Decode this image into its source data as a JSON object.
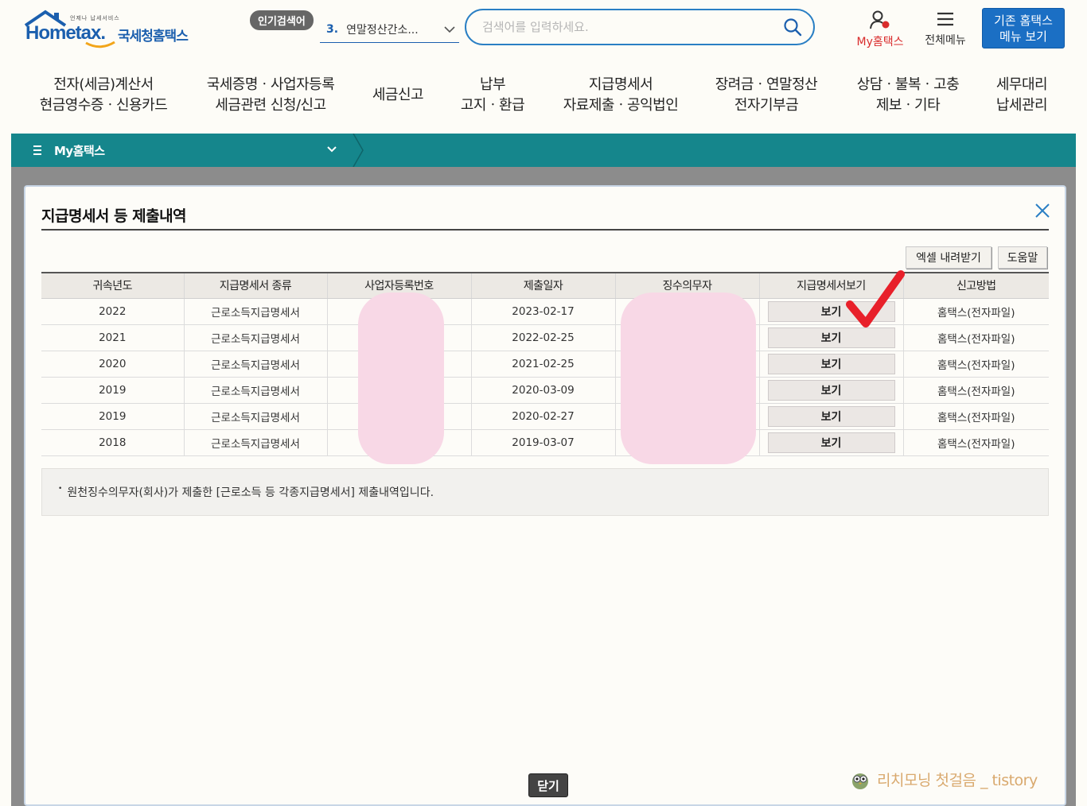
{
  "header": {
    "logo_tiny": "언제나 납세서비스",
    "logo_main": "Hometax.",
    "logo_sub": "국세청홈택스",
    "popular_badge": "인기검색어",
    "popular_num": "3.",
    "popular_text": "연말정산간소...",
    "search_placeholder": "검색어를 입력하세요.",
    "my_hometax": "My홈택스",
    "all_menu": "전체메뉴",
    "old_menu_line1": "기존 홈택스",
    "old_menu_line2": "메뉴 보기"
  },
  "gnb": [
    "전자(세금)계산서\n현금영수증ㆍ신용카드",
    "국세증명ㆍ사업자등록\n세금관련 신청/신고",
    "세금신고",
    "납부\n고지ㆍ환급",
    "지급명세서\n자료제출ㆍ공익법인",
    "장려금ㆍ연말정산\n전자기부금",
    "상담ㆍ불복ㆍ고충\n제보ㆍ기타",
    "세무대리\n납세관리"
  ],
  "mybar": {
    "label": "My홈택스"
  },
  "modal": {
    "title": "지급명세서 등 제출내역",
    "excel_button": "엑셀 내려받기",
    "help_button": "도움말",
    "columns": [
      "귀속년도",
      "지급명세서 종류",
      "사업자등록번호",
      "제출일자",
      "징수의무자",
      "지급명세서보기",
      "신고방법"
    ],
    "rows": [
      {
        "year": "2022",
        "type": "근로소득지급명세서",
        "bizno": "",
        "date": "2023-02-17",
        "payer": "",
        "view": "보기",
        "method": "홈택스(전자파일)"
      },
      {
        "year": "2021",
        "type": "근로소득지급명세서",
        "bizno": "",
        "date": "2022-02-25",
        "payer": "",
        "view": "보기",
        "method": "홈택스(전자파일)"
      },
      {
        "year": "2020",
        "type": "근로소득지급명세서",
        "bizno": "",
        "date": "2021-02-25",
        "payer": "",
        "view": "보기",
        "method": "홈택스(전자파일)"
      },
      {
        "year": "2019",
        "type": "근로소득지급명세서",
        "bizno": "",
        "date": "2020-03-09",
        "payer": "",
        "view": "보기",
        "method": "홈택스(전자파일)"
      },
      {
        "year": "2019",
        "type": "근로소득지급명세서",
        "bizno": "",
        "date": "2020-02-27",
        "payer": "",
        "view": "보기",
        "method": "홈택스(전자파일)"
      },
      {
        "year": "2018",
        "type": "근로소득지급명세서",
        "bizno": "",
        "date": "2019-03-07",
        "payer": "",
        "view": "보기",
        "method": "홈택스(전자파일)"
      }
    ],
    "notice": "원천징수의무자(회사)가 제출한 [근로소득 등 각종지급명세서] 제출내역입니다.",
    "close_button": "닫기"
  },
  "watermark": "리치모닝 첫걸음 _ tistory",
  "colors": {
    "brand_blue": "#1b5fae",
    "teal_bar": "#15868c",
    "my_red": "#d92c2c",
    "redact_pink": "#f8d8e6",
    "check_red": "#e8202a"
  }
}
